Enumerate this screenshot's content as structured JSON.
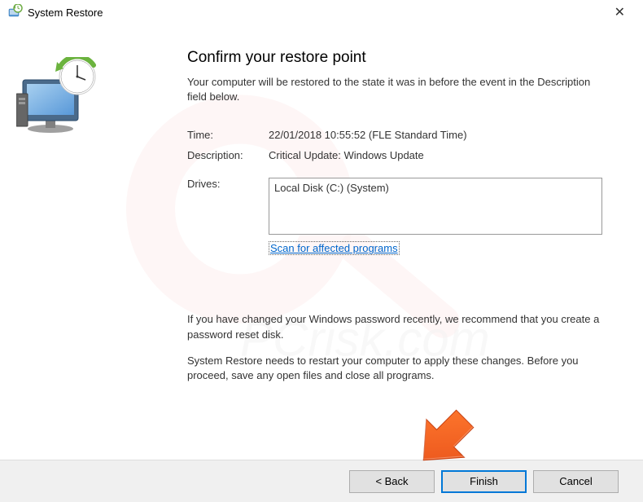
{
  "window": {
    "title": "System Restore"
  },
  "content": {
    "heading": "Confirm your restore point",
    "subtext": "Your computer will be restored to the state it was in before the event in the Description field below.",
    "time_label": "Time:",
    "time_value": "22/01/2018 10:55:52 (FLE Standard Time)",
    "description_label": "Description:",
    "description_value": "Critical Update: Windows Update",
    "drives_label": "Drives:",
    "drives_value": "Local Disk (C:) (System)",
    "scan_link": "Scan for affected programs",
    "warning_password": "If you have changed your Windows password recently, we recommend that you create a password reset disk.",
    "warning_restart": "System Restore needs to restart your computer to apply these changes. Before you proceed, save any open files and close all programs."
  },
  "buttons": {
    "back": "< Back",
    "finish": "Finish",
    "cancel": "Cancel"
  }
}
